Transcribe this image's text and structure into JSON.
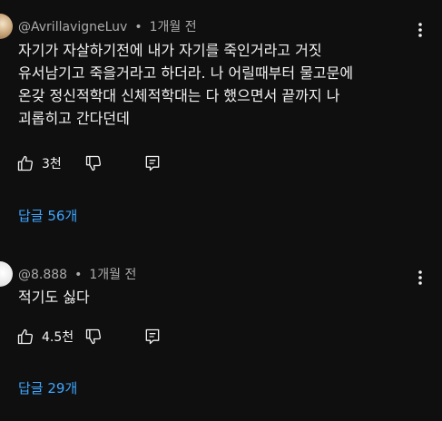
{
  "comments": [
    {
      "author": "@AvrillavigneLuv",
      "separator": "•",
      "time": "1개월 전",
      "text": "자기가 자살하기전에 내가 자기를 죽인거라고 거짓\n유서남기고 죽을거라고 하더라. 나 어릴때부터 물고문에\n온갖 정신적학대 신체적학대는 다 했으면서 끝까지 나\n괴롭히고 간다던데",
      "likes": "3천",
      "replies_label": "답글 56개"
    },
    {
      "author": "@8.888",
      "separator": "•",
      "time": "1개월 전",
      "text": "적기도 싫다",
      "likes": "4.5천",
      "replies_label": "답글 29개"
    }
  ],
  "icons": {
    "like": "thumbs-up-icon",
    "dislike": "thumbs-down-icon",
    "reply": "reply-comment-icon",
    "menu": "more-vert-icon"
  },
  "colors": {
    "background": "#0f0f0f",
    "text": "#f1f1f1",
    "meta": "#aaaaaa",
    "link": "#3ea6ff"
  }
}
